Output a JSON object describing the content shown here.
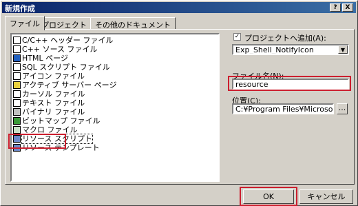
{
  "window": {
    "title": "新規作成",
    "help_button": "?",
    "close_button": "X"
  },
  "tabs": [
    "ファイル",
    "プロジェクト",
    "その他のドキュメント"
  ],
  "file_types": [
    "C/C++ ヘッダー ファイル",
    "C++ ソース ファイル",
    "HTML ページ",
    "SQL スクリプト ファイル",
    "アイコン ファイル",
    "アクティブ サーバー ページ",
    "カーソル ファイル",
    "テキスト ファイル",
    "バイナリ ファイル",
    "ビットマップ ファイル",
    "マクロ ファイル",
    "リソース スクリプト",
    "リソース テンプレート"
  ],
  "add_to_project": {
    "label": "プロジェクトへ追加(A):",
    "checked": true,
    "check_mark": "✓",
    "value": "Exp_Shell_NotifyIcon"
  },
  "filename": {
    "label": "ファイル名(N):",
    "value": "resource"
  },
  "location": {
    "label": "位置(C):",
    "value": "C:¥Program Files¥Microsoft Visual",
    "browse_label": "..."
  },
  "buttons": {
    "ok": "OK",
    "cancel": "キャンセル"
  },
  "colors": {
    "titlebar": "#0a246a",
    "highlight": "#cc1f2f"
  }
}
